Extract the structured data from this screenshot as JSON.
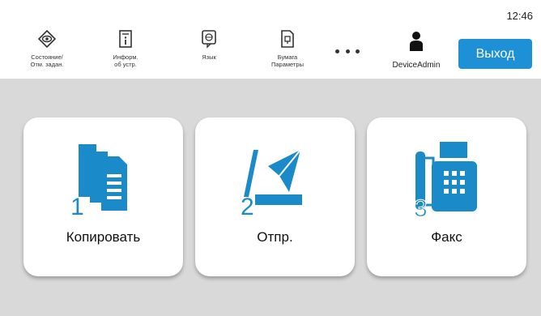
{
  "status_bar": {
    "time": "12:46"
  },
  "nav": [
    {
      "icon": "status-icon",
      "label": "Состояние/\nОтм. задан."
    },
    {
      "icon": "device-info-icon",
      "label": "Информ.\nоб устр."
    },
    {
      "icon": "language-icon",
      "label": "Язык"
    },
    {
      "icon": "paper-settings-icon",
      "label": "Бумага\nПараметры"
    }
  ],
  "more_icon": "more-dots-icon",
  "user": {
    "icon": "user-icon",
    "name": "DeviceAdmin"
  },
  "logout_label": "Выход",
  "tiles": [
    {
      "number": "1",
      "icon": "copy-icon",
      "label": "Копировать"
    },
    {
      "number": "2",
      "icon": "send-icon",
      "label": "Отпр."
    },
    {
      "number": "3",
      "icon": "fax-icon",
      "label": "Факс"
    }
  ],
  "colors": {
    "accent": "#1e90d6",
    "icon_blue": "#1b8ac9",
    "background": "#d9d9d9",
    "tile": "#ffffff"
  }
}
